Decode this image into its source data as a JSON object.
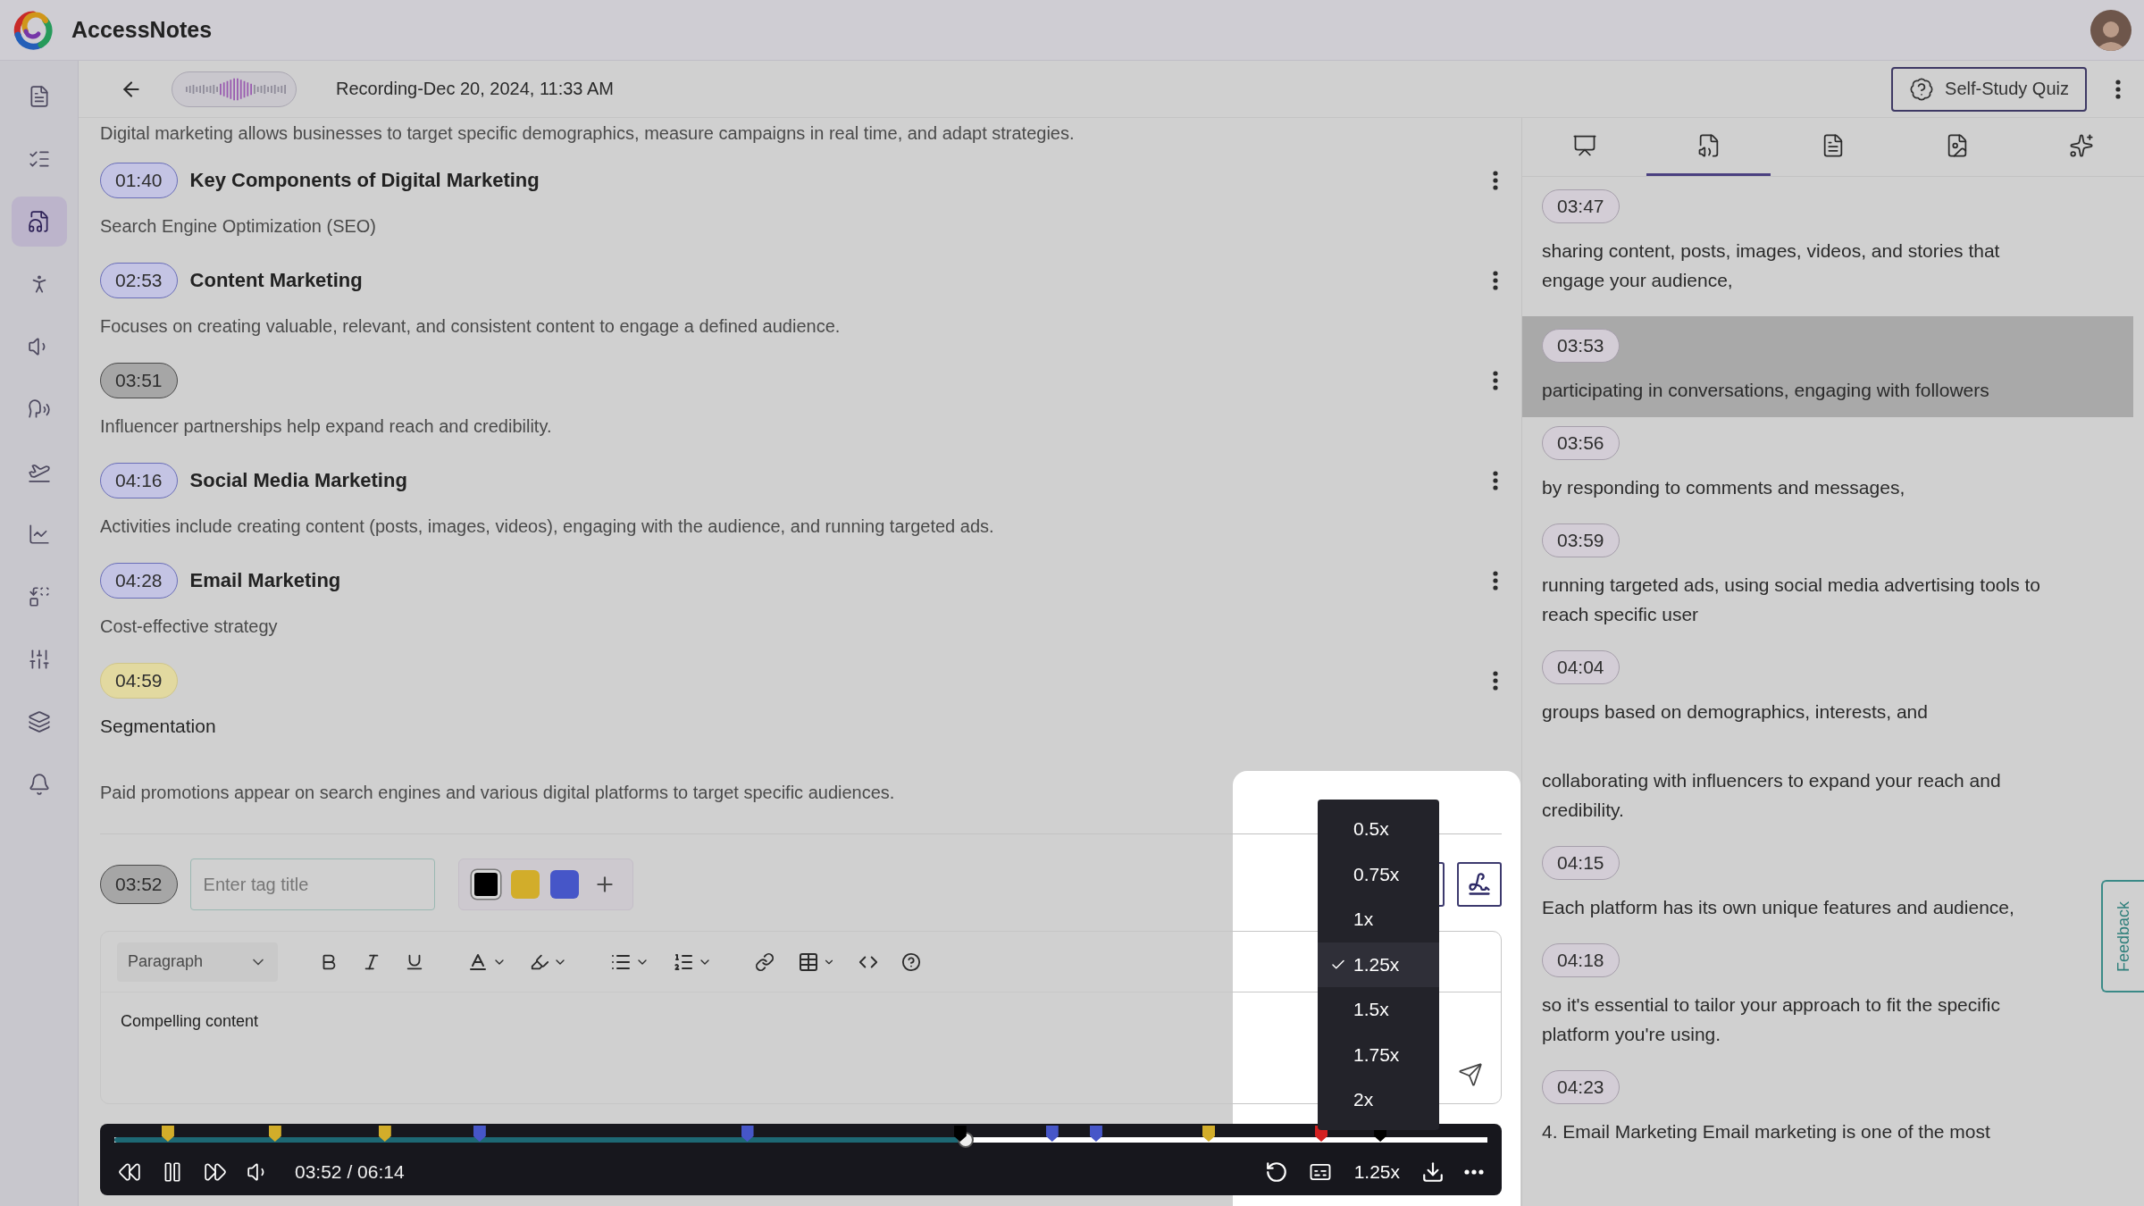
{
  "app": {
    "name": "AccessNotes"
  },
  "sidebar": {
    "items": [
      {
        "selected": false
      },
      {
        "selected": false
      },
      {
        "selected": true
      },
      {
        "selected": false
      },
      {
        "selected": false
      },
      {
        "selected": false
      },
      {
        "selected": false
      },
      {
        "selected": false
      },
      {
        "selected": false
      },
      {
        "selected": false
      },
      {
        "selected": false
      },
      {
        "selected": false
      }
    ]
  },
  "header": {
    "title": "Recording-Dec 20, 2024, 11:33 AM",
    "quiz_button": "Self-Study Quiz"
  },
  "notes": {
    "intro": "Digital marketing allows businesses to target specific demographics, measure campaigns in real time, and adapt strategies.",
    "entries": [
      {
        "time": "01:40",
        "color": "#c4c4e4",
        "title": "Key Components of Digital Marketing",
        "text": "Search Engine Optimization (SEO)"
      },
      {
        "time": "02:53",
        "color": "#c4c4e4",
        "title": "Content Marketing",
        "text": "Focuses on creating valuable, relevant, and consistent content to engage a defined audience."
      },
      {
        "time": "03:51",
        "color": "#a6a6a6",
        "text": "Influencer partnerships help expand reach and credibility."
      },
      {
        "time": "04:16",
        "color": "#c4c4e4",
        "title": "Social Media Marketing",
        "text": "Activities include creating content (posts, images, videos), engaging with the audience, and running targeted ads."
      },
      {
        "time": "04:28",
        "color": "#c4c4e4",
        "title": "Email Marketing",
        "text": "Cost-effective strategy"
      },
      {
        "time": "04:59",
        "color": "#e2d9a0",
        "subheading": "Segmentation",
        "text": "Paid promotions appear on search engines and various digital platforms to target specific audiences."
      }
    ]
  },
  "tag_editor": {
    "time": "03:52",
    "placeholder": "Enter tag title",
    "colors": [
      {
        "color": "#000000",
        "selected": true
      },
      {
        "color": "#d2ad2a",
        "selected": false
      },
      {
        "color": "#4656c8",
        "selected": false
      }
    ]
  },
  "editor": {
    "block_type": "Paragraph",
    "content": "Compelling content"
  },
  "player": {
    "time": "03:52 / 06:14",
    "level": 0.62,
    "speed": "1.25x",
    "markers": [
      {
        "color": "#d2ad2a"
      },
      {
        "color": "#d2ad2a"
      },
      {
        "color": "#d2ad2a"
      },
      {
        "color": "#4656c8"
      },
      {
        "color": "#4656c8"
      },
      {
        "color": "#000000"
      },
      {
        "color": "#4656c8"
      },
      {
        "color": "#4656c8"
      },
      {
        "color": "#d2ad2a"
      },
      {
        "color": "#d42020"
      },
      {
        "color": "#000000"
      }
    ]
  },
  "speed_menu": {
    "options": [
      {
        "label": "0.5x",
        "selected": false
      },
      {
        "label": "0.75x",
        "selected": false
      },
      {
        "label": "1x",
        "selected": false
      },
      {
        "label": "1.25x",
        "selected": true
      },
      {
        "label": "1.5x",
        "selected": false
      },
      {
        "label": "1.75x",
        "selected": false
      },
      {
        "label": "2x",
        "selected": false
      }
    ]
  },
  "right_panel": {
    "tabs": [
      {
        "selected": false
      },
      {
        "selected": true
      },
      {
        "selected": false
      },
      {
        "selected": false
      },
      {
        "selected": false
      }
    ],
    "transcript": [
      {
        "time": "03:47",
        "text": "sharing content, posts, images, videos, and stories that engage your audience,",
        "selected": false
      },
      {
        "time": "03:53",
        "text": "participating in conversations, engaging with followers",
        "selected": true
      },
      {
        "time": "03:56",
        "text": "by responding to comments and messages,",
        "selected": false
      },
      {
        "time": "03:59",
        "text": "running targeted ads, using social media advertising tools to reach specific user",
        "selected": false
      },
      {
        "time": "04:04",
        "text": "groups based on demographics, interests, and",
        "selected": false
      },
      {
        "text": "collaborating with influencers to expand your reach and credibility.",
        "selected": false
      },
      {
        "time": "04:15",
        "text": "Each platform has its own unique features and audience,",
        "selected": false
      },
      {
        "time": "04:18",
        "text": "so it's essential to tailor your approach to fit the specific platform you're using.",
        "selected": false
      },
      {
        "time": "04:23",
        "text": "4. Email Marketing Email marketing is one of the most",
        "selected": false
      }
    ]
  },
  "feedback_tab": "Feedback"
}
